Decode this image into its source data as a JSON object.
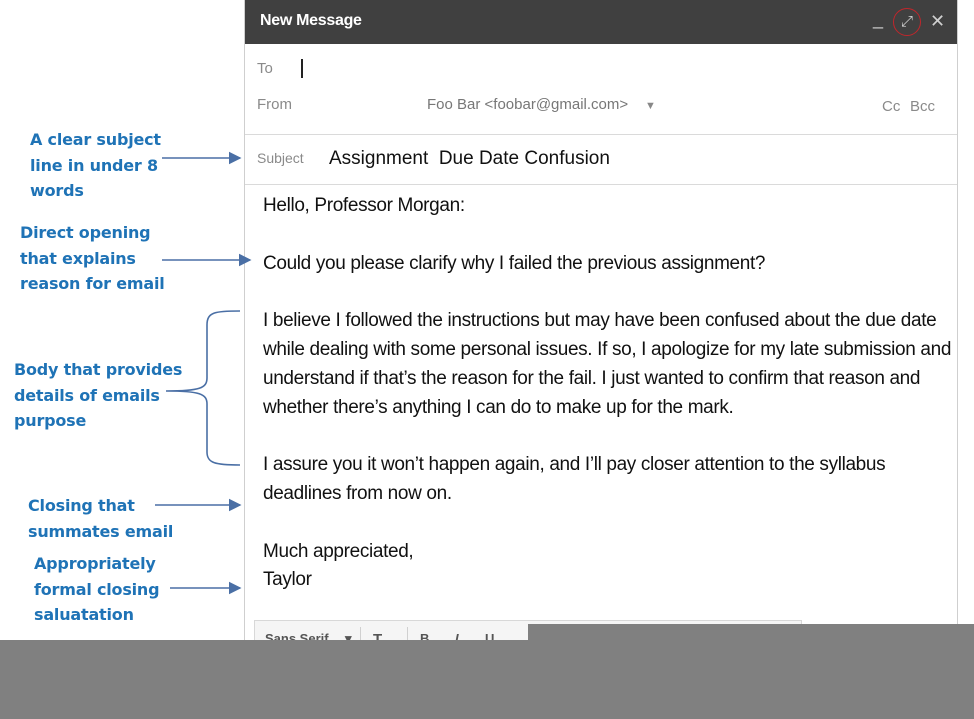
{
  "window": {
    "title": "New Message",
    "controls": {
      "minimize": "_",
      "maximize": "⤢",
      "close": "✕"
    }
  },
  "header": {
    "to_label": "To",
    "to_value": "",
    "from_label": "From",
    "from_value": "Foo Bar <foobar@gmail.com>",
    "from_dropdown": "▼",
    "cc_label": "Cc",
    "bcc_label": "Bcc",
    "subject_label": "Subject",
    "subject_value": "Assignment  Due Date Confusion"
  },
  "body": {
    "greeting": "Hello, Professor Morgan:",
    "opening": "Could you please clarify why I failed the previous assignment?",
    "details": "I believe I followed the instructions but may have been confused about the due date while dealing with some personal issues. If so, I apologize for my late submission and understand if that’s the reason for the fail. I just wanted to confirm that reason and whether there’s anything I can do to make up for the mark.",
    "closing": "I assure you it won’t happen again, and I’ll pay closer attention to the syllabus deadlines from now on.",
    "signoff": "Much appreciated,",
    "signature": "Taylor"
  },
  "toolbar": {
    "font": "Sans Serif",
    "font_dropdown": "▾",
    "size": "T",
    "bold": "B",
    "italic": "I",
    "underline": "U"
  },
  "annotations": [
    {
      "text": "A clear subject line in under 8 words",
      "lines": [
        "A clear subject",
        "line in under 8",
        "words"
      ]
    },
    {
      "text": "Direct opening that explains reason for email",
      "lines": [
        "Direct opening",
        "that explains",
        "reason for email"
      ]
    },
    {
      "text": "Body that provides details of emails purpose",
      "lines": [
        "Body that provides",
        "details of emails",
        "purpose"
      ]
    },
    {
      "text": "Closing that summates email",
      "lines": [
        "Closing that",
        "summates email"
      ]
    },
    {
      "text": "Appropriately formal closing saluatation",
      "lines": [
        "Appropriately",
        "formal closing",
        "saluatation"
      ]
    }
  ],
  "colors": {
    "annotation": "#1f73b6",
    "arrow": "#4a6fa5",
    "titlebar": "#404040",
    "highlight_circle": "#c0262b",
    "overlay": "#808080"
  }
}
